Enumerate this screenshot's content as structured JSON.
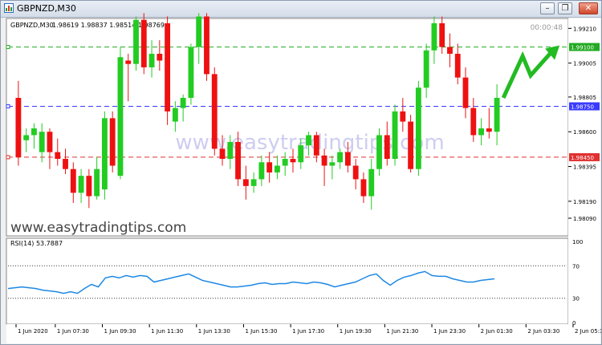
{
  "window": {
    "title": "GBPNZD,M30",
    "minimize_glyph": "–",
    "restore_glyph": "❐",
    "close_glyph": "✕",
    "app_icon": "chart-window-icon"
  },
  "chart_data": [
    {
      "type": "candlestick",
      "symbol_label": "GBPNZD,M30",
      "ohlc_label": "1.98619 1.98837 1.98514 1.98769",
      "timer": "00:00:48",
      "watermark": "www.easytradingtips.com",
      "watermark_bottom": "www.easytradingtips.com",
      "ylim": [
        1.98,
        1.9924
      ],
      "yticks": [
        "1.99210",
        "1.99005",
        "1.98805",
        "1.98600",
        "1.98395",
        "1.98190",
        "1.98090"
      ],
      "ytick_values": [
        1.9921,
        1.99005,
        1.98805,
        1.986,
        1.98395,
        1.9819,
        1.9809
      ],
      "xticks": [
        {
          "i": 0,
          "label": "1 Jun 2020"
        },
        {
          "i": 5,
          "label": "1 Jun 07:30"
        },
        {
          "i": 11,
          "label": "1 Jun 09:30"
        },
        {
          "i": 17,
          "label": "1 Jun 11:30"
        },
        {
          "i": 23,
          "label": "1 Jun 13:30"
        },
        {
          "i": 29,
          "label": "1 Jun 15:30"
        },
        {
          "i": 35,
          "label": "1 Jun 17:30"
        },
        {
          "i": 41,
          "label": "1 Jun 19:30"
        },
        {
          "i": 47,
          "label": "1 Jun 21:30"
        },
        {
          "i": 53,
          "label": "1 Jun 23:30"
        },
        {
          "i": 59,
          "label": "2 Jun 01:30"
        },
        {
          "i": 65,
          "label": "2 Jun 03:30"
        },
        {
          "i": 71,
          "label": "2 Jun 05:30"
        },
        {
          "i": 77,
          "label": "2 Jun 07:30"
        }
      ],
      "levels": [
        {
          "value": 1.991,
          "label": "1.99100",
          "color": "#22aa22"
        },
        {
          "value": 1.9875,
          "label": "1.98750",
          "color": "#3a3aff"
        },
        {
          "value": 1.9845,
          "label": "1.98450",
          "color": "#e03030"
        }
      ],
      "bull_color": "#22cc22",
      "bear_color": "#ee1111",
      "arrow_color": "#22bb22",
      "candles": [
        [
          1.988,
          1.989,
          1.984,
          1.9845
        ],
        [
          1.9855,
          1.9862,
          1.9848,
          1.9858
        ],
        [
          1.9858,
          1.9865,
          1.985,
          1.9862
        ],
        [
          1.9848,
          1.9865,
          1.9842,
          1.986
        ],
        [
          1.986,
          1.9862,
          1.9838,
          1.9848
        ],
        [
          1.9848,
          1.9856,
          1.984,
          1.9844
        ],
        [
          1.9844,
          1.985,
          1.9835,
          1.9838
        ],
        [
          1.9838,
          1.9842,
          1.9818,
          1.9824
        ],
        [
          1.9824,
          1.9838,
          1.9818,
          1.9834
        ],
        [
          1.9834,
          1.9838,
          1.9815,
          1.9822
        ],
        [
          1.9822,
          1.9845,
          1.982,
          1.9838
        ],
        [
          1.9826,
          1.9872,
          1.982,
          1.9868
        ],
        [
          1.9868,
          1.9872,
          1.9836,
          1.984
        ],
        [
          1.9834,
          1.991,
          1.9832,
          1.9904
        ],
        [
          1.9902,
          1.9906,
          1.9878,
          1.99
        ],
        [
          1.99,
          1.9928,
          1.9896,
          1.9926
        ],
        [
          1.9926,
          1.993,
          1.9894,
          1.9898
        ],
        [
          1.9898,
          1.9914,
          1.9892,
          1.9906
        ],
        [
          1.9906,
          1.9914,
          1.9896,
          1.9902
        ],
        [
          1.9924,
          1.9928,
          1.9864,
          1.9872
        ],
        [
          1.9866,
          1.9878,
          1.986,
          1.9874
        ],
        [
          1.9874,
          1.9882,
          1.9866,
          1.988
        ],
        [
          1.988,
          1.9912,
          1.9876,
          1.991
        ],
        [
          1.991,
          1.993,
          1.99,
          1.9928
        ],
        [
          1.9928,
          1.993,
          1.989,
          1.9894
        ],
        [
          1.9894,
          1.9898,
          1.9846,
          1.985
        ],
        [
          1.985,
          1.9858,
          1.984,
          1.9844
        ],
        [
          1.9844,
          1.9858,
          1.9838,
          1.9854
        ],
        [
          1.9854,
          1.986,
          1.9828,
          1.9832
        ],
        [
          1.9832,
          1.984,
          1.982,
          1.9828
        ],
        [
          1.9828,
          1.9836,
          1.9824,
          1.9832
        ],
        [
          1.9832,
          1.9846,
          1.9828,
          1.9842
        ],
        [
          1.9842,
          1.9848,
          1.983,
          1.9836
        ],
        [
          1.9836,
          1.9846,
          1.9832,
          1.984
        ],
        [
          1.984,
          1.9848,
          1.9834,
          1.9844
        ],
        [
          1.9844,
          1.985,
          1.9836,
          1.9842
        ],
        [
          1.9842,
          1.9856,
          1.9838,
          1.9852
        ],
        [
          1.9852,
          1.986,
          1.9846,
          1.9858
        ],
        [
          1.9858,
          1.986,
          1.9842,
          1.9846
        ],
        [
          1.9846,
          1.985,
          1.9828,
          1.984
        ],
        [
          1.984,
          1.9846,
          1.9832,
          1.9842
        ],
        [
          1.9842,
          1.985,
          1.9838,
          1.9848
        ],
        [
          1.9848,
          1.9854,
          1.9836,
          1.984
        ],
        [
          1.984,
          1.9844,
          1.9826,
          1.9832
        ],
        [
          1.9832,
          1.9836,
          1.9818,
          1.9822
        ],
        [
          1.9822,
          1.9844,
          1.9814,
          1.9838
        ],
        [
          1.9838,
          1.9862,
          1.9834,
          1.9858
        ],
        [
          1.9858,
          1.9866,
          1.984,
          1.9844
        ],
        [
          1.9844,
          1.9876,
          1.984,
          1.9872
        ],
        [
          1.9872,
          1.988,
          1.986,
          1.9866
        ],
        [
          1.9866,
          1.987,
          1.9836,
          1.9838
        ],
        [
          1.9838,
          1.989,
          1.9834,
          1.9886
        ],
        [
          1.9886,
          1.9912,
          1.988,
          1.9908
        ],
        [
          1.9908,
          1.9928,
          1.99,
          1.9924
        ],
        [
          1.9924,
          1.9928,
          1.9906,
          1.991
        ],
        [
          1.991,
          1.9918,
          1.9898,
          1.9906
        ],
        [
          1.9906,
          1.9912,
          1.9888,
          1.9892
        ],
        [
          1.9892,
          1.9898,
          1.9868,
          1.9874
        ],
        [
          1.9874,
          1.988,
          1.9854,
          1.9858
        ],
        [
          1.9858,
          1.9868,
          1.9852,
          1.9862
        ],
        [
          1.9862,
          1.9874,
          1.9856,
          1.986
        ],
        [
          1.986,
          1.9888,
          1.9852,
          1.988
        ]
      ]
    },
    {
      "type": "line",
      "indicator_label": "RSI(14) 53.7887",
      "ylim": [
        0,
        100
      ],
      "yticks": [
        100,
        70,
        30,
        0
      ],
      "levels": [
        70,
        30
      ],
      "series": [
        {
          "color": "#1e88e5",
          "values": [
            42,
            43,
            44,
            43,
            42,
            40,
            39,
            38,
            36,
            38,
            36,
            42,
            47,
            44,
            55,
            57,
            55,
            58,
            56,
            58,
            57,
            50,
            52,
            54,
            56,
            58,
            60,
            56,
            52,
            50,
            48,
            46,
            44,
            44,
            45,
            46,
            48,
            49,
            47,
            48,
            48,
            50,
            49,
            48,
            50,
            49,
            47,
            44,
            46,
            48,
            50,
            54,
            58,
            60,
            52,
            46,
            52,
            56,
            58,
            61,
            63,
            58,
            57,
            57,
            54,
            52,
            50,
            50,
            52,
            53,
            54
          ]
        }
      ]
    }
  ]
}
